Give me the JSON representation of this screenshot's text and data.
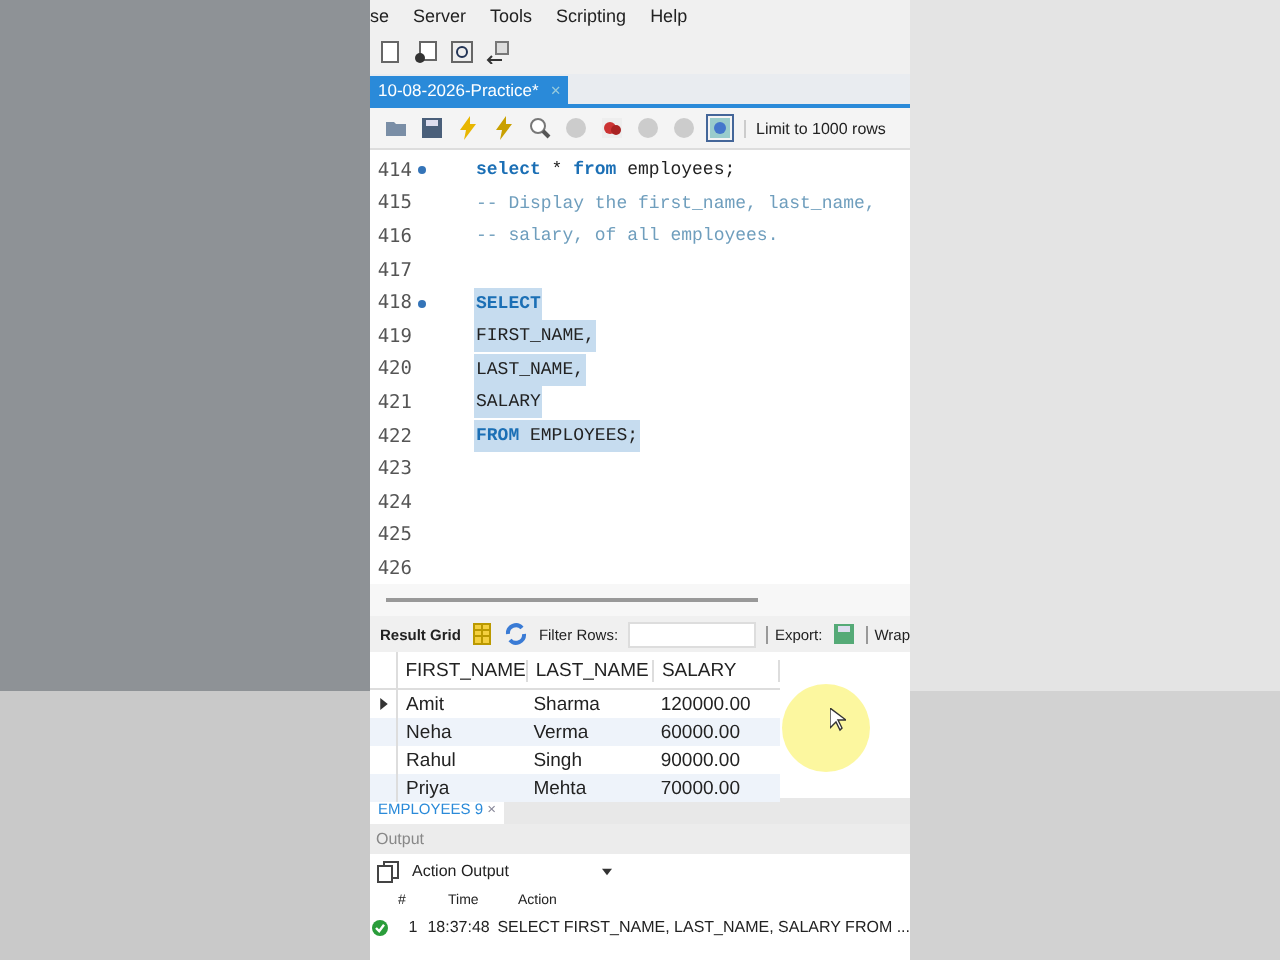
{
  "menu": [
    "se",
    "Server",
    "Tools",
    "Scripting",
    "Help"
  ],
  "query_tab": {
    "title": "10-08-2026-Practice*",
    "close": "×"
  },
  "editor_toolbar": {
    "limit": "Limit to 1000 rows"
  },
  "code_lines": [
    {
      "number": "414",
      "statement_start": true,
      "selected": false,
      "tokens": [
        {
          "kind": "keyword",
          "text": "select"
        },
        {
          "kind": "text",
          "text": " * "
        },
        {
          "kind": "keyword",
          "text": "from"
        },
        {
          "kind": "text",
          "text": " employees;"
        }
      ]
    },
    {
      "number": "415",
      "statement_start": false,
      "selected": false,
      "tokens": [
        {
          "kind": "comment",
          "text": "-- Display the first_name, last_name,"
        }
      ]
    },
    {
      "number": "416",
      "statement_start": false,
      "selected": false,
      "tokens": [
        {
          "kind": "comment",
          "text": "-- salary, of all employees."
        }
      ]
    },
    {
      "number": "417",
      "statement_start": false,
      "selected": false
    },
    {
      "number": "418",
      "statement_start": true,
      "selected": true,
      "tokens": [
        {
          "kind": "keyword",
          "text": "SELECT"
        }
      ]
    },
    {
      "number": "419",
      "statement_start": false,
      "selected": true,
      "tokens": [
        {
          "kind": "text",
          "text": "FIRST_NAME,"
        }
      ]
    },
    {
      "number": "420",
      "statement_start": false,
      "selected": true,
      "tokens": [
        {
          "kind": "text",
          "text": "LAST_NAME,"
        }
      ]
    },
    {
      "number": "421",
      "statement_start": false,
      "selected": true,
      "tokens": [
        {
          "kind": "text",
          "text": "SALARY"
        }
      ]
    },
    {
      "number": "422",
      "statement_start": false,
      "selected": true,
      "tokens": [
        {
          "kind": "keyword",
          "text": "FROM"
        },
        {
          "kind": "text",
          "text": " EMPLOYEES;"
        }
      ]
    },
    {
      "number": "423",
      "statement_start": false,
      "selected": false
    },
    {
      "number": "424",
      "statement_start": false,
      "selected": false
    },
    {
      "number": "425",
      "statement_start": false,
      "selected": false
    },
    {
      "number": "426",
      "statement_start": false,
      "selected": false
    }
  ],
  "result_toolbar": {
    "title": "Result Grid",
    "filter_label": "Filter Rows:",
    "export_label": "Export:",
    "wrap_label": "Wrap"
  },
  "table": {
    "columns": [
      "FIRST_NAME",
      "LAST_NAME",
      "SALARY"
    ],
    "rows": [
      {
        "current": true,
        "cells": [
          "Amit",
          "Sharma",
          "120000.00"
        ]
      },
      {
        "current": false,
        "cells": [
          "Neha",
          "Verma",
          "60000.00"
        ]
      },
      {
        "current": false,
        "cells": [
          "Rahul",
          "Singh",
          "90000.00"
        ]
      },
      {
        "current": false,
        "cells": [
          "Priya",
          "Mehta",
          "70000.00"
        ]
      }
    ]
  },
  "result_tab": {
    "title": "EMPLOYEES 9",
    "close": "×"
  },
  "output": {
    "title": "Output",
    "dropdown": "Action Output",
    "columns": [
      "#",
      "Time",
      "Action"
    ],
    "rows": [
      {
        "succeeded": true,
        "number": "1",
        "time": "18:37:48",
        "action": "SELECT  FIRST_NAME, LAST_NAME, SALARY FROM ..."
      }
    ]
  }
}
